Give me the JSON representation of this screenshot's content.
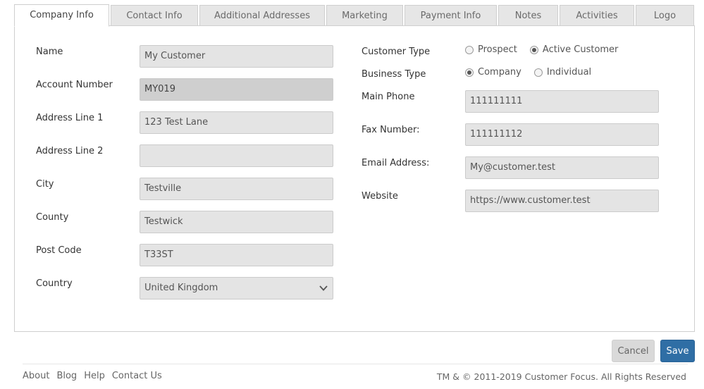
{
  "tabs": [
    "Company Info",
    "Contact Info",
    "Additional Addresses",
    "Marketing",
    "Payment Info",
    "Notes",
    "Activities",
    "Logo"
  ],
  "active_tab": "Company Info",
  "left_form": {
    "name": {
      "label": "Name",
      "value": "My Customer"
    },
    "account_number": {
      "label": "Account Number",
      "value": "MY019"
    },
    "address_line_1": {
      "label": "Address Line 1",
      "value": "123 Test Lane"
    },
    "address_line_2": {
      "label": "Address Line 2",
      "value": ""
    },
    "city": {
      "label": "City",
      "value": "Testville"
    },
    "county": {
      "label": "County",
      "value": "Testwick"
    },
    "post_code": {
      "label": "Post Code",
      "value": "T33ST"
    },
    "country": {
      "label": "Country",
      "value": "United Kingdom"
    }
  },
  "right_form": {
    "customer_type": {
      "label": "Customer Type",
      "options": [
        "Prospect",
        "Active Customer"
      ],
      "selected": "Active Customer"
    },
    "business_type": {
      "label": "Business Type",
      "options": [
        "Company",
        "Individual"
      ],
      "selected": "Company"
    },
    "main_phone": {
      "label": "Main Phone",
      "value": "111111111"
    },
    "fax_number": {
      "label": "Fax Number:",
      "value": "111111112"
    },
    "email": {
      "label": "Email Address:",
      "value": "My@customer.test"
    },
    "website": {
      "label": "Website",
      "value": "https://www.customer.test"
    }
  },
  "buttons": {
    "cancel": "Cancel",
    "save": "Save"
  },
  "footer": {
    "links": [
      "About",
      "Blog",
      "Help",
      "Contact Us"
    ],
    "copyright": "TM & © 2011-2019 Customer Focus. All Rights Reserved"
  },
  "colors": {
    "primary": "#2f6ea5",
    "field_bg": "#e4e4e4",
    "readonly_bg": "#cfcfcf"
  },
  "icons": {
    "country_dropdown": "chevron-down-icon"
  }
}
